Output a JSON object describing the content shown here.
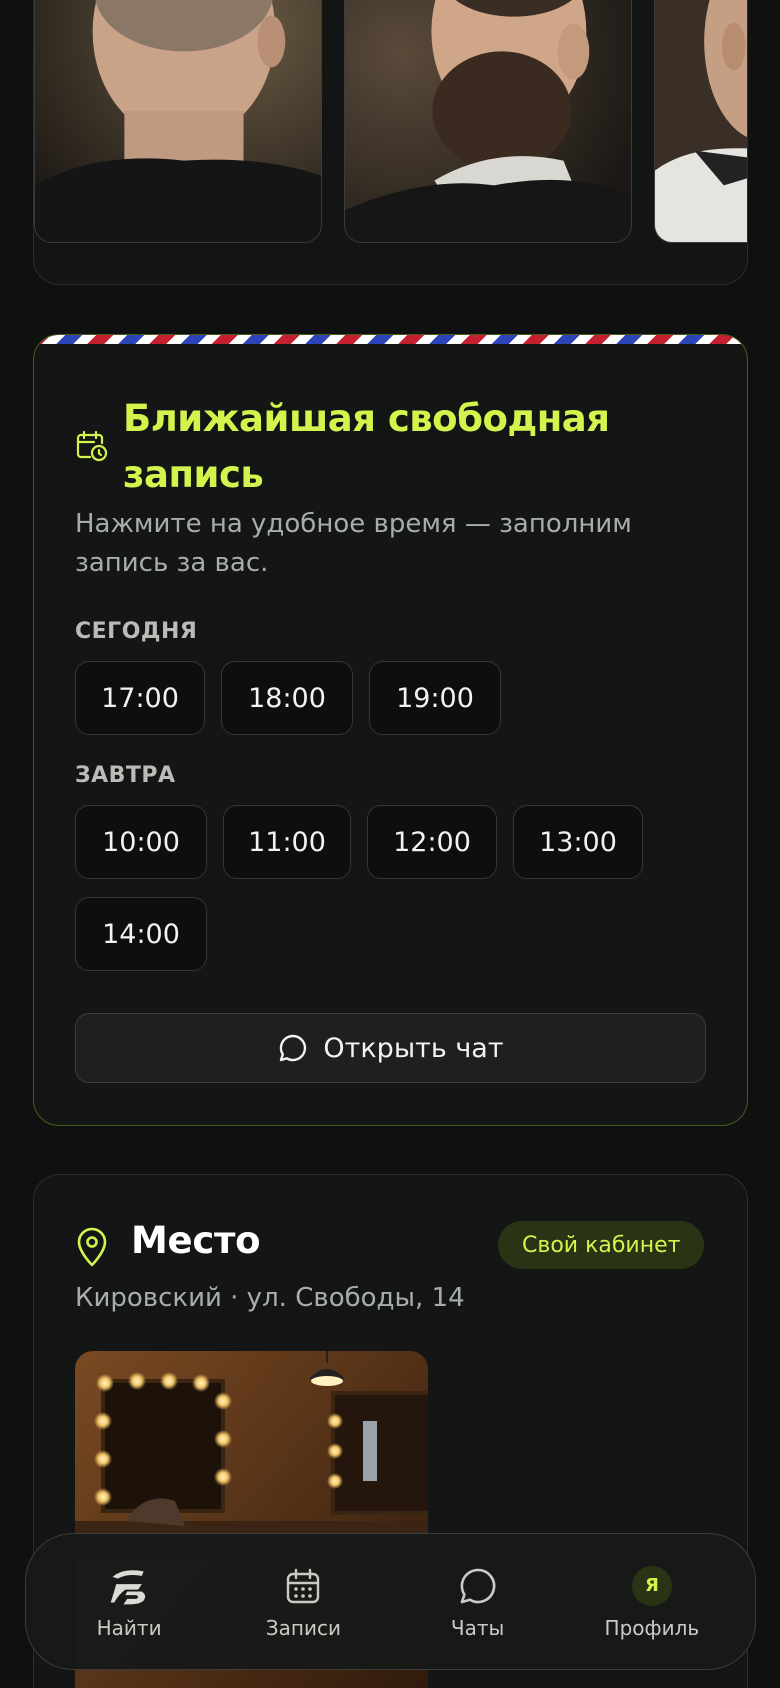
{
  "slots": {
    "title": "Ближайшая свободная запись",
    "subtitle": "Нажмите на удобное время — заполним запись за вас.",
    "today_label": "СЕГОДНЯ",
    "today_times": [
      "17:00",
      "18:00",
      "19:00"
    ],
    "tomorrow_label": "ЗАВТРА",
    "tomorrow_times": [
      "10:00",
      "11:00",
      "12:00",
      "13:00",
      "14:00"
    ],
    "chat_button": "Открыть чат"
  },
  "place": {
    "title": "Место",
    "badge": "Свой кабинет",
    "address": "Кировский · ул. Свободы, 14"
  },
  "nav": {
    "items": [
      {
        "label": "Найти",
        "icon": "logo-icon"
      },
      {
        "label": "Записи",
        "icon": "calendar-icon"
      },
      {
        "label": "Чаты",
        "icon": "chat-icon"
      },
      {
        "label": "Профиль",
        "icon": "avatar",
        "avatar_text": "Я"
      }
    ]
  },
  "colors": {
    "accent": "#d4f34c",
    "background": "#0f1110",
    "card": "#141615"
  }
}
